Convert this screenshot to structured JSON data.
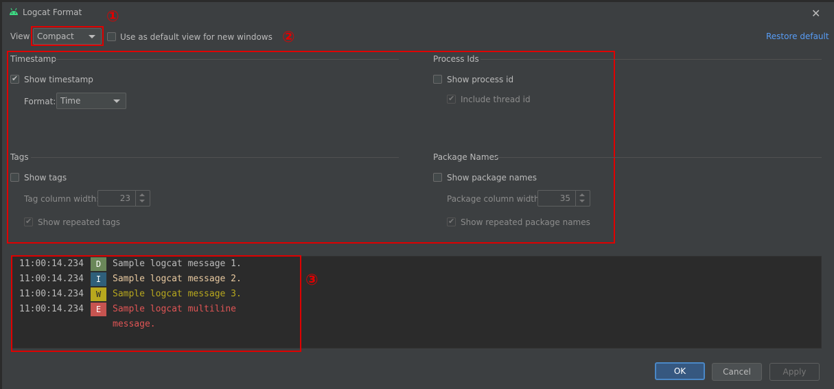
{
  "dialog": {
    "title": "Logcat Format",
    "close_glyph": "✕"
  },
  "view": {
    "label": "View",
    "selected": "Compact",
    "default_checkbox_label": "Use as default view for new windows",
    "default_checked": false,
    "restore_link": "Restore default"
  },
  "timestamp": {
    "section_title": "Timestamp",
    "show_label": "Show timestamp",
    "show_checked": true,
    "format_label": "Format:",
    "format_value": "Time"
  },
  "process_ids": {
    "section_title": "Process Ids",
    "show_label": "Show process id",
    "show_checked": false,
    "thread_label": "Include thread id",
    "thread_checked": true
  },
  "tags": {
    "section_title": "Tags",
    "show_label": "Show tags",
    "show_checked": false,
    "width_label": "Tag column width:",
    "width_value": "23",
    "repeated_label": "Show repeated tags",
    "repeated_checked": true
  },
  "package_names": {
    "section_title": "Package Names",
    "show_label": "Show package names",
    "show_checked": false,
    "width_label": "Package column width:",
    "width_value": "35",
    "repeated_label": "Show repeated package names",
    "repeated_checked": true
  },
  "preview": {
    "lines": [
      {
        "time": "11:00:14.234",
        "level": "D",
        "message": "Sample logcat message 1."
      },
      {
        "time": "11:00:14.234",
        "level": "I",
        "message": "Sample logcat message 2."
      },
      {
        "time": "11:00:14.234",
        "level": "W",
        "message": "Sample logcat message 3."
      },
      {
        "time": "11:00:14.234",
        "level": "E",
        "message": "Sample logcat multiline",
        "continuation": "message."
      }
    ]
  },
  "annotations": {
    "marker1": "①",
    "marker2": "②",
    "marker3": "③"
  },
  "buttons": {
    "ok": "OK",
    "cancel": "Cancel",
    "apply": "Apply"
  },
  "colors": {
    "accent_link": "#589df6",
    "annotation_red": "#e00000",
    "level_d_bg": "#6a8759",
    "level_i_bg": "#2f5f7a",
    "level_w_bg": "#b8a81e",
    "level_e_bg": "#c75450",
    "msg_d": "#bbbbbb",
    "msg_i": "#e8c9a0",
    "msg_w": "#b8a81e",
    "msg_e": "#e05555"
  }
}
